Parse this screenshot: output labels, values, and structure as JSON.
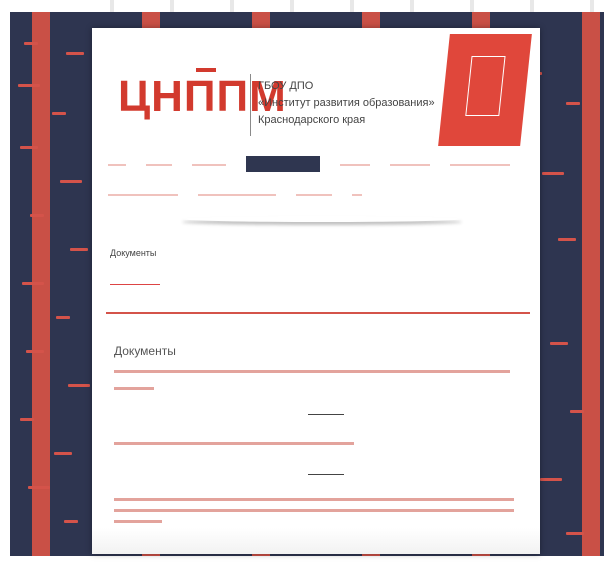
{
  "logo": {
    "text_main": "ЦНППМ",
    "text_red": ""
  },
  "org": {
    "line1": "ГБОУ ДПО",
    "line2": "«Институт развития образования»",
    "line3": "Краснодарского края"
  },
  "banner": {
    "text": ""
  },
  "nav": {
    "items": [
      {
        "label": "",
        "active": false
      },
      {
        "label": "",
        "active": false
      },
      {
        "label": "",
        "active": false
      },
      {
        "label": "",
        "active": true
      },
      {
        "label": "",
        "active": false
      },
      {
        "label": "",
        "active": false
      },
      {
        "label": "",
        "active": false
      },
      {
        "label": "",
        "active": false
      },
      {
        "label": "",
        "active": false
      },
      {
        "label": "",
        "active": false
      },
      {
        "label": "",
        "active": false
      }
    ]
  },
  "page": {
    "heading": "Документы",
    "breadcrumb": [
      "",
      "",
      ""
    ],
    "content_title": "Документы"
  },
  "colors": {
    "navy": "#2e3550",
    "accent_red": "#d23a2e",
    "link_red": "#d06a60"
  },
  "footer_text": ""
}
